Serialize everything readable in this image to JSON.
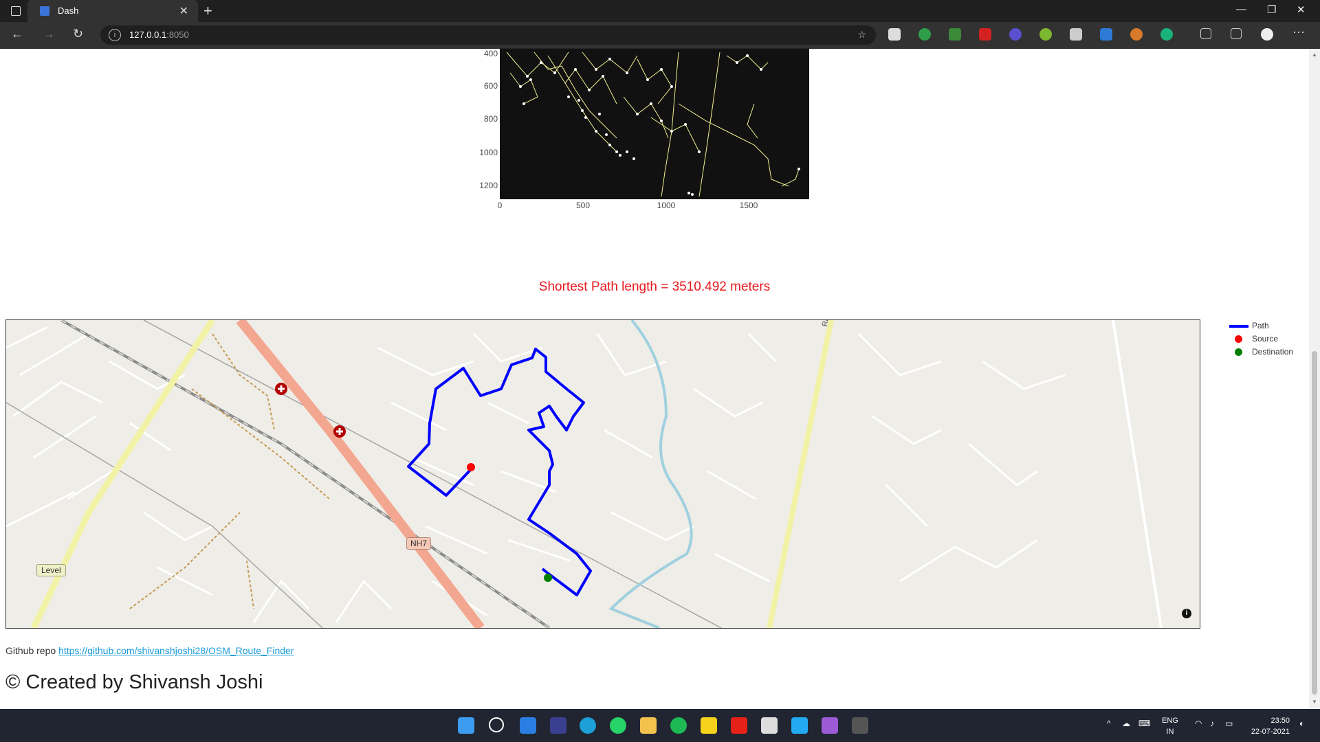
{
  "browser": {
    "tab_title": "Dash",
    "url_host": "127.0.0.1",
    "url_port": ":8050"
  },
  "graph": {
    "y_ticks": [
      "400",
      "600",
      "800",
      "1000",
      "1200"
    ],
    "x_ticks": [
      "0",
      "500",
      "1000",
      "1500"
    ]
  },
  "result": {
    "text": "Shortest Path length = 3510.492 meters",
    "color": "#e8191c"
  },
  "map": {
    "labels": {
      "level": "Level",
      "nh7": "NH7",
      "raipur": "Raipur Ro"
    },
    "legend": [
      {
        "name": "Path",
        "color": "#0000ff",
        "kind": "line"
      },
      {
        "name": "Source",
        "color": "#ff0000",
        "kind": "dot"
      },
      {
        "name": "Destination",
        "color": "#008000",
        "kind": "dot"
      }
    ]
  },
  "footer": {
    "github_label": "Github repo",
    "github_link": "https://github.com/shivanshjoshi28/OSM_Route_Finder",
    "credit": "© Created by Shivansh Joshi"
  },
  "taskbar": {
    "lang_top": "ENG",
    "lang_bottom": "IN",
    "time": "23:50",
    "date": "22-07-2021"
  }
}
